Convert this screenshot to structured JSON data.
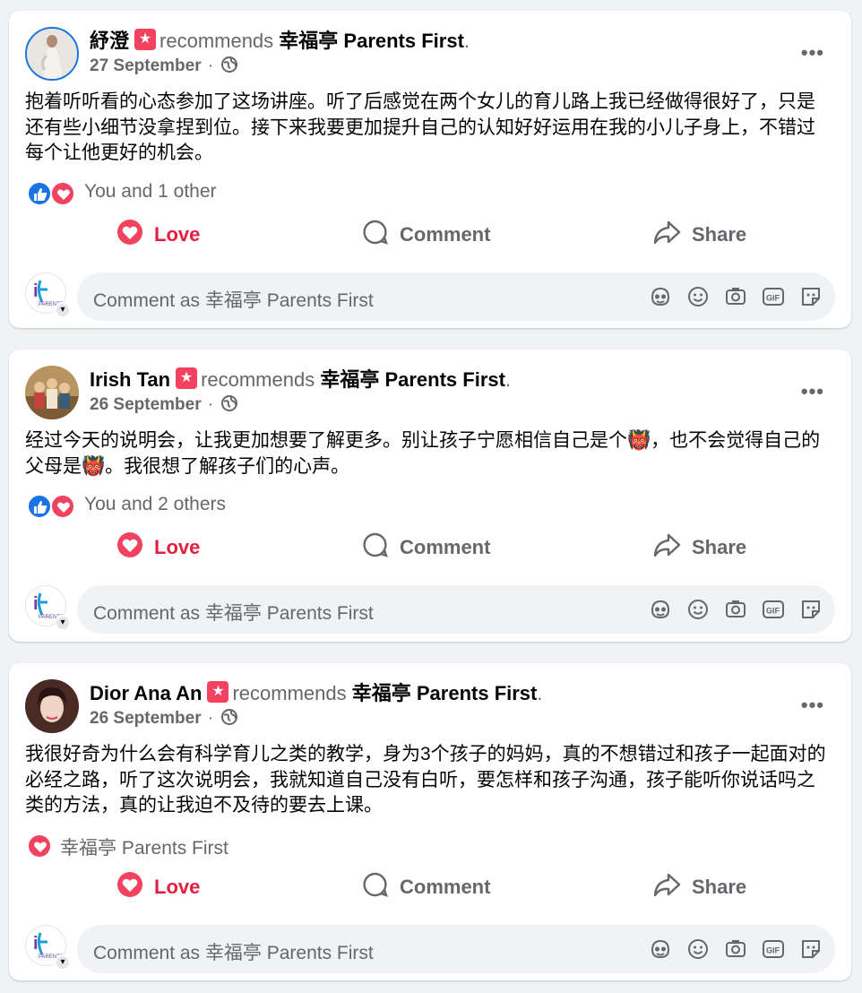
{
  "posts": [
    {
      "author": "紓澄",
      "recommends_text": "recommends",
      "page": "幸福亭 Parents First",
      "period": ".",
      "date": "27 September",
      "dot": "·",
      "content": "抱着听听看的心态参加了这场讲座。听了后感觉在两个女儿的育儿路上我已经做得很好了，只是还有些小细节没拿捏到位。接下来我要更加提升自己的认知好好运用在我的小儿子身上，不错过每个让他更好的机会。",
      "reactions_text": "You and 1 other",
      "reaction_icons": [
        "like-icon",
        "love-icon"
      ]
    },
    {
      "author": "Irish Tan",
      "recommends_text": "recommends",
      "page": "幸福亭 Parents First",
      "period": ".",
      "date": "26 September",
      "dot": "·",
      "content": "经过今天的说明会，让我更加想要了解更多。别让孩子宁愿相信自己是个👹，也不会觉得自己的父母是👹。我很想了解孩子们的心声。",
      "reactions_text": "You and 2 others",
      "reaction_icons": [
        "like-icon",
        "love-icon"
      ]
    },
    {
      "author": "Dior Ana An",
      "recommends_text": "recommends",
      "page": "幸福亭 Parents First",
      "period": ".",
      "date": "26 September",
      "dot": "·",
      "content": "我很好奇为什么会有科学育儿之类的教学，身为3个孩子的妈妈，真的不想错过和孩子一起面对的必经之路，听了这次说明会，我就知道自己没有白听，要怎样和孩子沟通，孩子能听你说话吗之类的方法，真的让我迫不及待的要去上课。",
      "reactions_text": "幸福亭 Parents First",
      "reaction_icons": [
        "love-icon"
      ]
    }
  ],
  "actions": {
    "love": "Love",
    "comment": "Comment",
    "share": "Share"
  },
  "composer": {
    "placeholder": "Comment as 幸福亭 Parents First"
  },
  "more_label": "•••",
  "colors": {
    "love": "#e41e3f",
    "like": "#1b74e4",
    "muted": "#65676b",
    "background": "#f0f2f5"
  }
}
